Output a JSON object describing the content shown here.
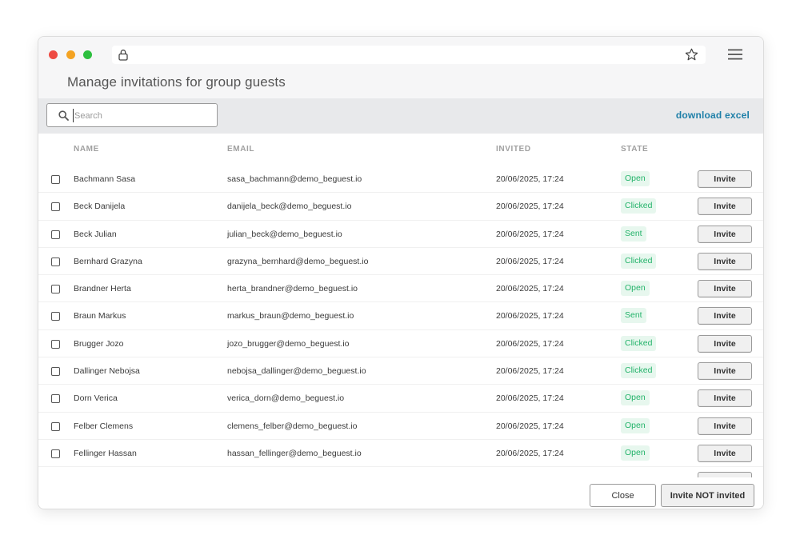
{
  "browser": {
    "icons": [
      "lock-icon",
      "star-icon",
      "menu-icon"
    ]
  },
  "page": {
    "title": "Manage invitations for group guests"
  },
  "toolbar": {
    "search_placeholder": "Search",
    "search_value": "",
    "download_label": "download excel"
  },
  "table": {
    "columns": {
      "name": "NAME",
      "email": "EMAIL",
      "invited": "INVITED",
      "state": "STATE"
    },
    "rows": [
      {
        "name": "Bachmann Sasa",
        "email": "sasa_bachmann@demo_beguest.io",
        "invited": "20/06/2025, 17:24",
        "state": "Open",
        "action": "Invite"
      },
      {
        "name": "Beck Danijela",
        "email": "danijela_beck@demo_beguest.io",
        "invited": "20/06/2025, 17:24",
        "state": "Clicked",
        "action": "Invite"
      },
      {
        "name": "Beck Julian",
        "email": "julian_beck@demo_beguest.io",
        "invited": "20/06/2025, 17:24",
        "state": "Sent",
        "action": "Invite"
      },
      {
        "name": "Bernhard Grazyna",
        "email": "grazyna_bernhard@demo_beguest.io",
        "invited": "20/06/2025, 17:24",
        "state": "Clicked",
        "action": "Invite"
      },
      {
        "name": "Brandner Herta",
        "email": "herta_brandner@demo_beguest.io",
        "invited": "20/06/2025, 17:24",
        "state": "Open",
        "action": "Invite"
      },
      {
        "name": "Braun Markus",
        "email": "markus_braun@demo_beguest.io",
        "invited": "20/06/2025, 17:24",
        "state": "Sent",
        "action": "Invite"
      },
      {
        "name": "Brugger Jozo",
        "email": "jozo_brugger@demo_beguest.io",
        "invited": "20/06/2025, 17:24",
        "state": "Clicked",
        "action": "Invite"
      },
      {
        "name": "Dallinger Nebojsa",
        "email": "nebojsa_dallinger@demo_beguest.io",
        "invited": "20/06/2025, 17:24",
        "state": "Clicked",
        "action": "Invite"
      },
      {
        "name": "Dorn Verica",
        "email": "verica_dorn@demo_beguest.io",
        "invited": "20/06/2025, 17:24",
        "state": "Open",
        "action": "Invite"
      },
      {
        "name": "Felber Clemens",
        "email": "clemens_felber@demo_beguest.io",
        "invited": "20/06/2025, 17:24",
        "state": "Open",
        "action": "Invite"
      },
      {
        "name": "Fellinger Hassan",
        "email": "hassan_fellinger@demo_beguest.io",
        "invited": "20/06/2025, 17:24",
        "state": "Open",
        "action": "Invite"
      }
    ]
  },
  "footer": {
    "close_label": "Close",
    "invite_not_invited_label": "Invite NOT invited"
  },
  "colors": {
    "accent_link": "#1d7fa8",
    "state_green": "#23b36a",
    "state_bg": "#e7f7ee"
  }
}
